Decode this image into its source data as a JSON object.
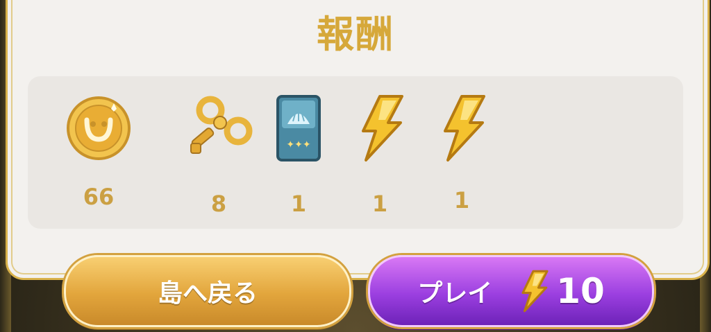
{
  "title": "報酬",
  "rewards": [
    {
      "icon": "gold-coin-icon",
      "count": "66"
    },
    {
      "icon": "wind-up-key-icon",
      "count": "8"
    },
    {
      "icon": "card-pack-icon",
      "count": "1"
    },
    {
      "icon": "lightning-bolt-icon",
      "count": "1"
    },
    {
      "icon": "lightning-bolt-icon",
      "count": "1"
    }
  ],
  "buttons": {
    "back_label": "島へ戻る",
    "play_label": "プレイ",
    "play_cost": "10"
  },
  "colors": {
    "accent_gold": "#d6a83a",
    "back_button": "#e2a53c",
    "play_button": "#9b3fe0",
    "panel_bg": "#f3f1ee"
  }
}
